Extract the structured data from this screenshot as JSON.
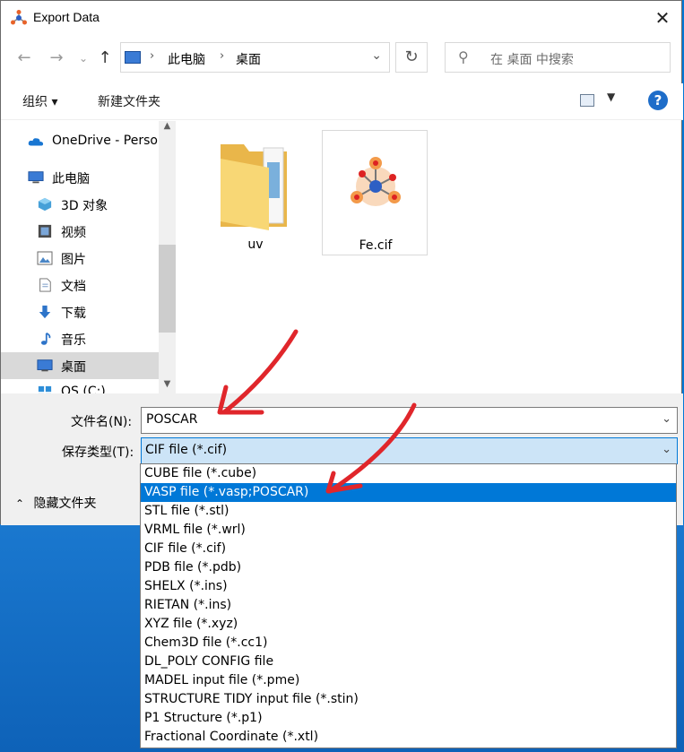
{
  "window": {
    "title": "Export Data",
    "close_icon": "close-icon"
  },
  "nav": {
    "back_icon": "←",
    "forward_icon": "→",
    "history_icon": "⌄",
    "up_icon": "↑",
    "path": [
      "此电脑",
      "桌面"
    ],
    "refresh_icon": "↻",
    "search_placeholder": "在 桌面 中搜索"
  },
  "toolbar": {
    "organize": "组织 ▾",
    "new_folder": "新建文件夹",
    "help": "?"
  },
  "sidebar": {
    "items": [
      {
        "label": "OneDrive - Perso",
        "icon": "onedrive-icon"
      },
      {
        "label": "此电脑",
        "icon": "computer-icon"
      },
      {
        "label": "3D 对象",
        "icon": "3d-objects-icon"
      },
      {
        "label": "视频",
        "icon": "video-icon"
      },
      {
        "label": "图片",
        "icon": "pictures-icon"
      },
      {
        "label": "文档",
        "icon": "documents-icon"
      },
      {
        "label": "下载",
        "icon": "download-icon"
      },
      {
        "label": "音乐",
        "icon": "music-icon"
      },
      {
        "label": "桌面",
        "icon": "desktop-icon",
        "selected": true
      },
      {
        "label": "OS (C:)",
        "icon": "drive-icon"
      }
    ]
  },
  "files": [
    {
      "name": "uv",
      "type": "folder"
    },
    {
      "name": "Fe.cif",
      "type": "cif"
    }
  ],
  "form": {
    "filename_label": "文件名(N):",
    "filename_value": "POSCAR",
    "filetype_label": "保存类型(T):",
    "filetype_value": "CIF file (*.cif)",
    "hide_folders": "隐藏文件夹"
  },
  "filetype_options": [
    "CUBE file (*.cube)",
    "VASP file (*.vasp;POSCAR)",
    "STL file (*.stl)",
    "VRML file (*.wrl)",
    "CIF file (*.cif)",
    "PDB file (*.pdb)",
    "SHELX (*.ins)",
    "RIETAN (*.ins)",
    "XYZ file (*.xyz)",
    "Chem3D file (*.cc1)",
    "DL_POLY CONFIG file",
    "MADEL input file (*.pme)",
    "STRUCTURE TIDY input file (*.stin)",
    "P1 Structure (*.p1)",
    "Fractional Coordinate (*.xtl)"
  ],
  "highlighted_option": "VASP file (*.vasp;POSCAR)",
  "colors": {
    "accent": "#0078d7",
    "annotation": "#e0262b"
  }
}
